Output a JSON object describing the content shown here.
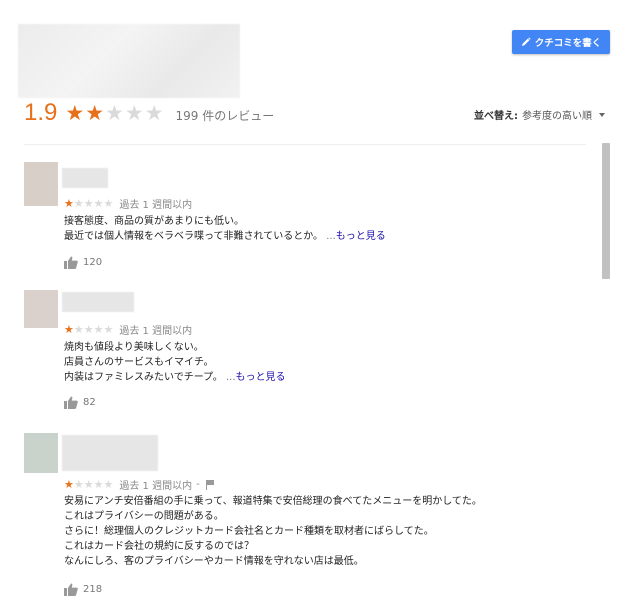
{
  "header": {
    "write_review_label": "クチコミを書く",
    "rating": "1.9",
    "rating_value": 1.9,
    "rating_stars": 2,
    "review_count_label": "199 件のレビュー",
    "sort_prefix": "並べ替え:",
    "sort_value": "参考度の高い順"
  },
  "colors": {
    "accent": "#e7711b",
    "button": "#4285f4",
    "link": "#1a0dab"
  },
  "reviews": [
    {
      "stars": 1,
      "time": "過去 1 週間以内",
      "lines": [
        "接客態度、商品の質があまりにも低い。",
        "最近では個人情報をベラベラ喋って非難されているとか。"
      ],
      "ellipsis": "...",
      "more_label": "もっと見る",
      "likes": "120"
    },
    {
      "stars": 1,
      "time": "過去 1 週間以内",
      "lines": [
        "焼肉も値段より美味しくない。",
        "店員さんのサービスもイマイチ。",
        "内装はファミレスみたいでチープ。"
      ],
      "ellipsis": "...",
      "more_label": "もっと見る",
      "likes": "82"
    },
    {
      "stars": 1,
      "time": "過去 1 週間以内",
      "sep": "-",
      "lines": [
        "安易にアンチ安倍番組の手に乗って、報道特集で安倍総理の食べてたメニューを明かしてた。",
        "これはプライバシーの問題がある。",
        "さらに！総理個人のクレジットカード会社名とカード種類を取材者にばらしてた。",
        "これはカード会社の規約に反するのでは？",
        "なんにしろ、客のプライバシーやカード情報を守れない店は最低。"
      ],
      "likes": "218"
    }
  ]
}
